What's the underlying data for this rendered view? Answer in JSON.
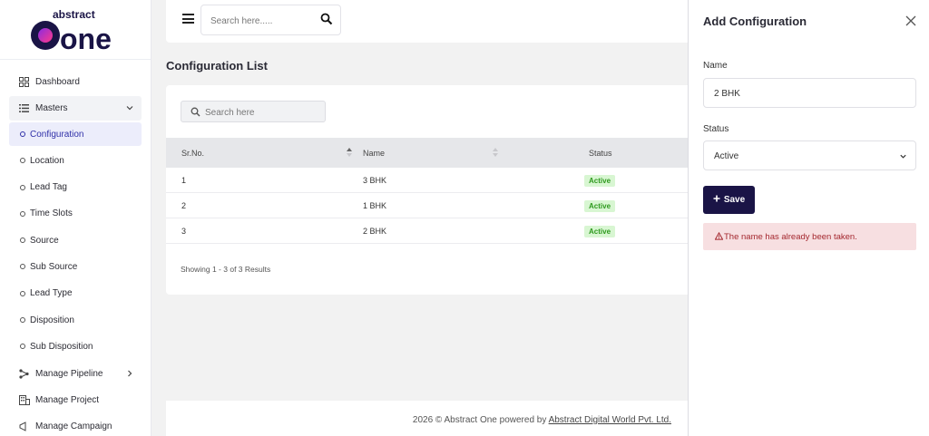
{
  "brand": {
    "logo_top": "abstract",
    "logo_main": "one"
  },
  "sidebar": {
    "items": [
      {
        "label": "Dashboard",
        "icon": "grid-icon"
      },
      {
        "label": "Masters",
        "icon": "list-icon"
      }
    ],
    "sub_items": [
      {
        "label": "Configuration"
      },
      {
        "label": "Location"
      },
      {
        "label": "Lead Tag"
      },
      {
        "label": "Time Slots"
      },
      {
        "label": "Source"
      },
      {
        "label": "Sub Source"
      },
      {
        "label": "Lead Type"
      },
      {
        "label": "Disposition"
      },
      {
        "label": "Sub Disposition"
      }
    ],
    "bottom_items": [
      {
        "label": "Manage Pipeline",
        "icon": "pipeline-icon"
      },
      {
        "label": "Manage Project",
        "icon": "building-icon"
      },
      {
        "label": "Manage Campaign",
        "icon": "campaign-icon"
      }
    ]
  },
  "topbar": {
    "search_placeholder": "Search here....."
  },
  "page": {
    "title": "Configuration List"
  },
  "table": {
    "search_placeholder": "Search here",
    "headers": [
      "Sr.No.",
      "Name",
      "Status"
    ],
    "rows": [
      {
        "sr": "1",
        "name": "3 BHK",
        "status": "Active"
      },
      {
        "sr": "2",
        "name": "1 BHK",
        "status": "Active"
      },
      {
        "sr": "3",
        "name": "2 BHK",
        "status": "Active"
      }
    ],
    "showing": "Showing 1 - 3 of 3 Results"
  },
  "footer": {
    "text": "2026 © Abstract One powered by ",
    "link": "Abstract Digital World Pvt. Ltd."
  },
  "panel": {
    "title": "Add Configuration",
    "name_label": "Name",
    "name_value": "2 BHK",
    "status_label": "Status",
    "status_value": "Active",
    "save_label": "Save",
    "error": "The name has already been taken."
  },
  "colors": {
    "accent": "#1a1446",
    "active_badge": "#2e9a1e",
    "error": "#a4282f"
  }
}
